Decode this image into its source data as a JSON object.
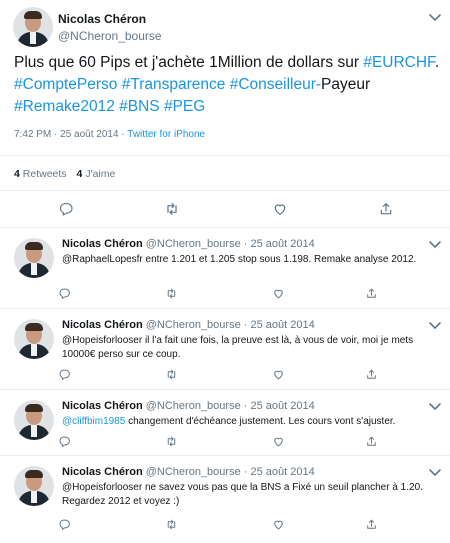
{
  "tweet": {
    "author_name": "Nicolas Chéron",
    "author_handle": "@NCheron_bourse",
    "text_before": "Plus que 60 Pips et j'achète 1Million de dollars sur ",
    "hashtags": [
      "#EURCHF",
      "#ComptePerso",
      "#Transparence",
      "#Conseilleur-",
      "#Remake2012",
      "#BNS",
      "#PEG"
    ],
    "text_payeur": "Payeur ",
    "time": "7:42 PM",
    "date": "25 août 2014",
    "separator": "·",
    "client": "Twitter for iPhone",
    "retweets_count": "4",
    "retweets_label": "Retweets",
    "likes_count": "4",
    "likes_label": "J'aime"
  },
  "replies": [
    {
      "name": "Nicolas Chéron",
      "handle": "@NCheron_bourse",
      "dot": "·",
      "date": "25 août 2014",
      "mention": "",
      "text": "@RaphaelLopesfr entre 1.201 et 1.205 stop sous 1.198. Remake analyse 2012."
    },
    {
      "name": "Nicolas Chéron",
      "handle": "@NCheron_bourse",
      "dot": "·",
      "date": "25 août 2014",
      "mention": "",
      "text": "@Hopeisforlooser il l'a fait une fois, la preuve est là, à vous de voir, moi je mets 10000€ perso sur ce coup."
    },
    {
      "name": "Nicolas Chéron",
      "handle": "@NCheron_bourse",
      "dot": "·",
      "date": "25 août 2014",
      "mention": "@cliffbim1985",
      "text": " changement d'échéance justement. Les cours vont s'ajuster."
    },
    {
      "name": "Nicolas Chéron",
      "handle": "@NCheron_bourse",
      "dot": "·",
      "date": "25 août 2014",
      "mention": "",
      "text": "@Hopeisforlooser ne savez vous pas que la BNS a Fixé un seuil plancher à 1.20. Regardez 2012 et voyez :)"
    }
  ],
  "icons": [
    "reply-icon",
    "retweet-icon",
    "like-icon",
    "share-icon",
    "chevron-down-icon"
  ],
  "colors": {
    "link": "#1b95e0",
    "secondary_text": "#657786",
    "divider": "#e6ecf0"
  }
}
